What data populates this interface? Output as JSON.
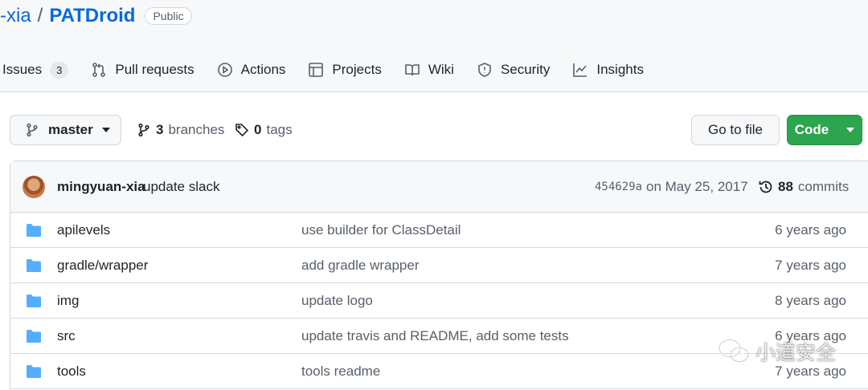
{
  "repo": {
    "owner": "-xia",
    "separator": "/",
    "name": "PATDroid",
    "visibility": "Public"
  },
  "tabs": [
    {
      "label": "Issues",
      "icon": "issue-icon",
      "counter": "3"
    },
    {
      "label": "Pull requests",
      "icon": "pull-request-icon"
    },
    {
      "label": "Actions",
      "icon": "play-icon"
    },
    {
      "label": "Projects",
      "icon": "table-icon"
    },
    {
      "label": "Wiki",
      "icon": "book-icon"
    },
    {
      "label": "Security",
      "icon": "shield-icon"
    },
    {
      "label": "Insights",
      "icon": "graph-icon"
    }
  ],
  "toolbar": {
    "branch": "master",
    "branch_count": "3",
    "branch_label": "branches",
    "tag_count": "0",
    "tag_label": "tags",
    "goto_file": "Go to file",
    "code": "Code"
  },
  "commit": {
    "author": "mingyuan-xia",
    "message": "update slack",
    "sha": "454629a",
    "date": "on May 25, 2017",
    "count": "88",
    "count_label": "commits"
  },
  "files": [
    {
      "name": "apilevels",
      "message": "use builder for ClassDetail",
      "age": "6 years ago"
    },
    {
      "name": "gradle/wrapper",
      "message": "add gradle wrapper",
      "age": "7 years ago"
    },
    {
      "name": "img",
      "message": "update logo",
      "age": "8 years ago"
    },
    {
      "name": "src",
      "message": "update travis and README, add some tests",
      "age": "6 years ago"
    },
    {
      "name": "tools",
      "message": "tools readme",
      "age": "7 years ago"
    }
  ],
  "watermark": {
    "text": "小道安全"
  },
  "colors": {
    "link": "#0969da",
    "code_button": "#2da44e",
    "folder": "#54aeff",
    "header_bg": "#f6f8fa"
  }
}
